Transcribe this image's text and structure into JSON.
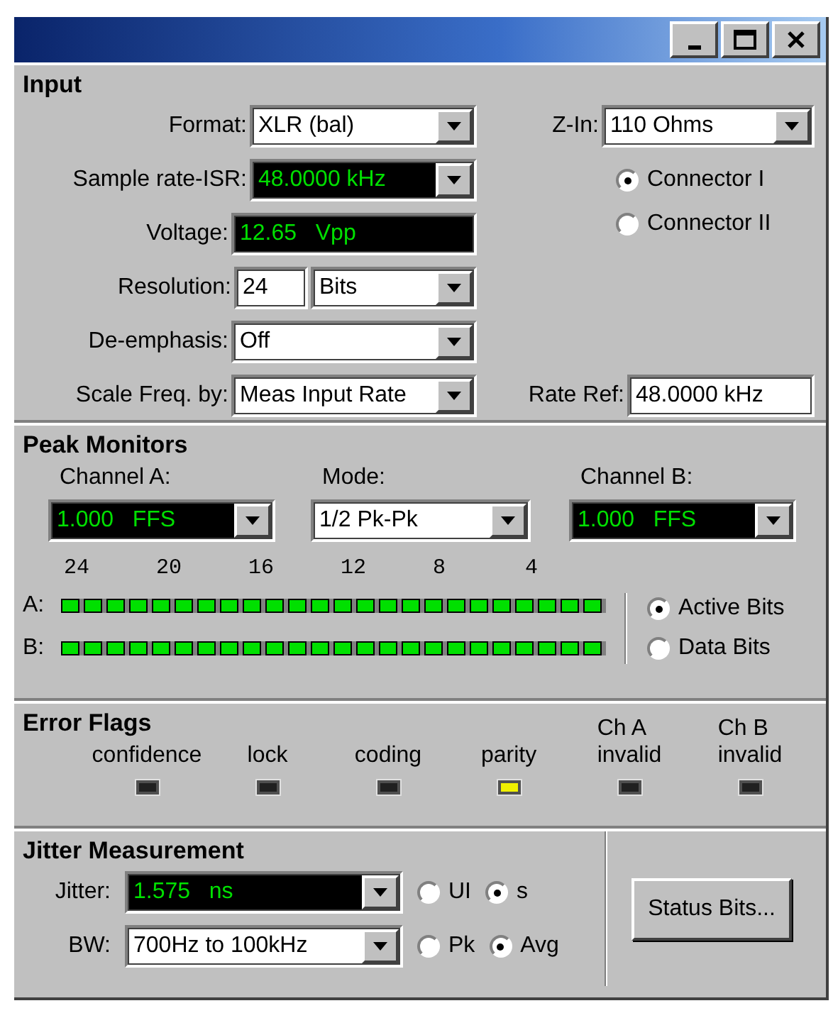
{
  "input": {
    "title": "Input",
    "format": {
      "label": "Format:",
      "value": "XLR (bal)"
    },
    "z_in": {
      "label": "Z-In:",
      "value": "110 Ohms"
    },
    "sample_rate": {
      "label": "Sample rate-ISR:",
      "value": "48.0000 kHz"
    },
    "connectors": [
      {
        "label": "Connector I",
        "selected": true
      },
      {
        "label": "Connector II",
        "selected": false
      }
    ],
    "voltage": {
      "label": "Voltage:",
      "value": "12.65   Vpp"
    },
    "resolution": {
      "label": "Resolution:",
      "value": "24",
      "unit": "Bits"
    },
    "deemphasis": {
      "label": "De-emphasis:",
      "value": "Off"
    },
    "scale_freq": {
      "label": "Scale Freq. by:",
      "value": "Meas Input Rate"
    },
    "rate_ref": {
      "label": "Rate Ref:",
      "value": "48.0000 kHz"
    }
  },
  "peak_monitors": {
    "title": "Peak Monitors",
    "selectors": [
      {
        "label": "Channel A:",
        "value": "1.000   FFS",
        "kind": "readout"
      },
      {
        "label": "Mode:",
        "value": "1/2 Pk-Pk",
        "kind": "plain"
      },
      {
        "label": "Channel B:",
        "value": "1.000   FFS",
        "kind": "readout"
      }
    ],
    "scale": [
      "24",
      "20",
      "16",
      "12",
      "8",
      "4"
    ],
    "meters": [
      {
        "label": "A:",
        "level": 1
      },
      {
        "label": "B:",
        "level": 1
      }
    ],
    "bit_modes": [
      {
        "label": "Active Bits",
        "selected": true
      },
      {
        "label": "Data Bits",
        "selected": false
      }
    ]
  },
  "error_flags": {
    "title": "Error Flags",
    "flags": [
      {
        "label": "confidence",
        "on": false
      },
      {
        "label": "lock",
        "on": false
      },
      {
        "label": "coding",
        "on": false
      },
      {
        "label": "parity",
        "on": true
      },
      {
        "label": "Ch A\ninvalid",
        "on": false
      },
      {
        "label": "Ch B\ninvalid",
        "on": false
      }
    ]
  },
  "jitter": {
    "title": "Jitter Measurement",
    "jitter": {
      "label": "Jitter:",
      "value": "1.575   ns"
    },
    "units": [
      {
        "label": "UI",
        "selected": false
      },
      {
        "label": "s",
        "selected": true
      }
    ],
    "bw": {
      "label": "BW:",
      "value": "700Hz to 100kHz"
    },
    "detectors": [
      {
        "label": "Pk",
        "selected": false
      },
      {
        "label": "Avg",
        "selected": true
      }
    ],
    "button": "Status Bits..."
  }
}
